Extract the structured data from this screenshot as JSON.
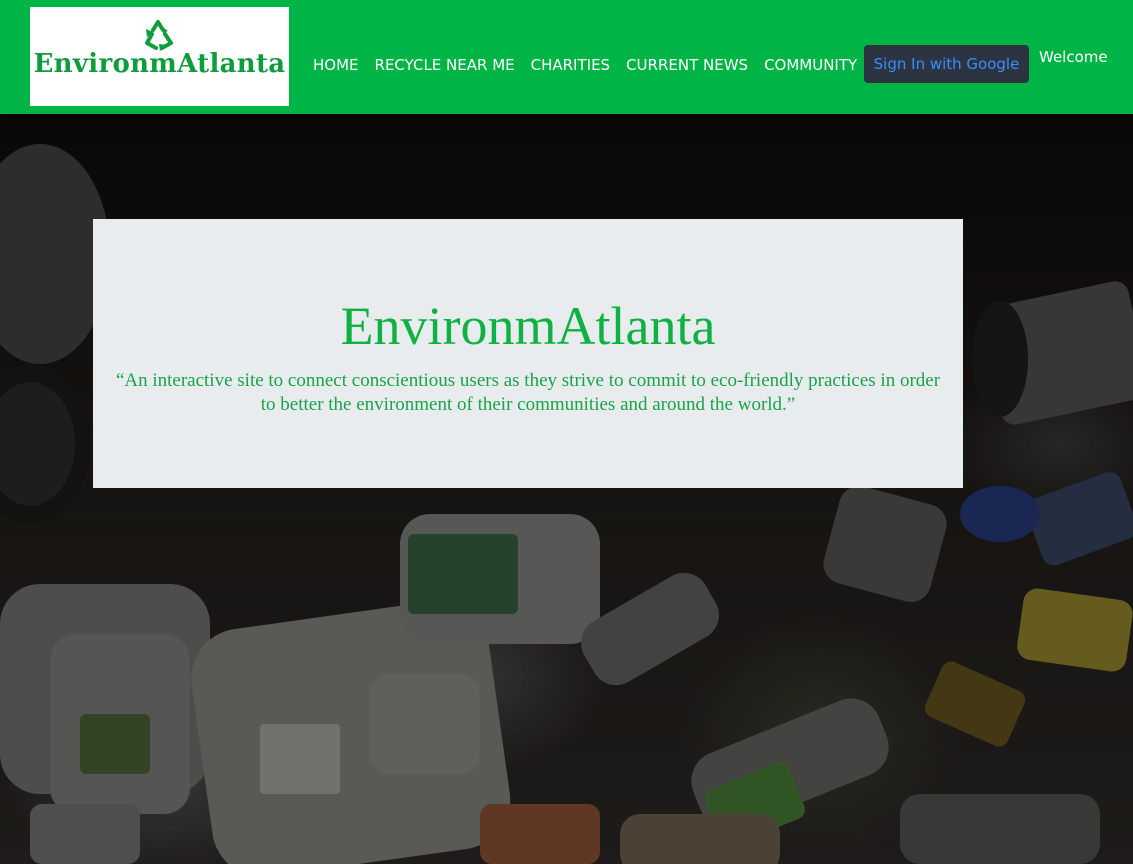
{
  "brand": {
    "logo_text": "EnvironmAtlanta",
    "logo_icon": "recycle-icon",
    "color": "#0e9c3c"
  },
  "nav": {
    "background": "#00b545",
    "links": [
      "HOME",
      "RECYCLE NEAR ME",
      "CHARITIES",
      "CURRENT NEWS",
      "COMMUNITY"
    ],
    "sign_in_label": "Sign In with Google",
    "welcome_text": "Welcome"
  },
  "hero": {
    "title": "EnvironmAtlanta",
    "tagline": "“An interactive site to connect conscientious users as they strive to commit to eco-friendly practices in order to better the environment of their communities and around the world.”",
    "background_image": "recyclables-pile-photo"
  }
}
